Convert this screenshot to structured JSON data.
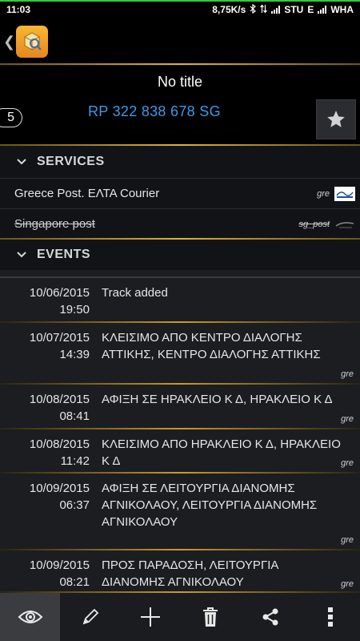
{
  "status_bar": {
    "time": "11:03",
    "net_speed": "8,75K/s",
    "carrier1": "STU",
    "net_type": "E",
    "carrier2": "WHA"
  },
  "header": {
    "title": "No title",
    "count": "5",
    "tracking_number": "RP 322 838 678 SG"
  },
  "services": {
    "label": "SERVICES",
    "items": [
      {
        "name": "Greece Post. ΕΛΤΑ Courier",
        "code": "gre"
      },
      {
        "name": "Singapore post",
        "code": "sg_post"
      }
    ]
  },
  "events": {
    "label": "EVENTS",
    "items": [
      {
        "date": "10/06/2015",
        "time": "19:50",
        "description": "Track added",
        "source": ""
      },
      {
        "date": "10/07/2015",
        "time": "14:39",
        "description": "ΚΛΕΙΣΙΜΟ ΑΠΟ ΚΕΝΤΡΟ ΔΙΑΛΟΓΗΣ ΑΤΤΙΚΗΣ, ΚΕΝΤΡΟ ΔΙΑΛΟΓΗΣ ΑΤΤΙΚΗΣ",
        "source": "gre"
      },
      {
        "date": "10/08/2015",
        "time": "08:41",
        "description": "ΑΦΙΞΗ ΣΕ ΗΡΑΚΛΕΙΟ Κ Δ, ΗΡΑΚΛΕΙΟ Κ Δ",
        "source": "gre"
      },
      {
        "date": "10/08/2015",
        "time": "11:42",
        "description": "ΚΛΕΙΣΙΜΟ ΑΠΟ ΗΡΑΚΛΕΙΟ Κ Δ, ΗΡΑΚΛΕΙΟ Κ Δ",
        "source": "gre"
      },
      {
        "date": "10/09/2015",
        "time": "06:37",
        "description": "ΑΦΙΞΗ ΣΕ ΛΕΙΤΟΥΡΓΙΑ ΔΙΑΝΟΜΗΣ ΑΓΝΙΚΟΛΑΟΥ, ΛΕΙΤΟΥΡΓΙΑ ΔΙΑΝΟΜΗΣ ΑΓΝΙΚΟΛΑΟΥ",
        "source": "gre"
      },
      {
        "date": "10/09/2015",
        "time": "08:21",
        "description": "ΠΡΟΣ ΠΑΡΑΔΟΣΗ, ΛΕΙΤΟΥΡΓΙΑ ΔΙΑΝΟΜΗΣ ΑΓΝΙΚΟΛΑΟΥ",
        "source": "gre"
      }
    ]
  },
  "toolbar": {
    "icons": [
      "eye-icon",
      "pencil-icon",
      "plus-icon",
      "trash-icon",
      "share-icon",
      "more-vert-icon"
    ]
  },
  "colors": {
    "accent_gold": "#e0b23c",
    "link_blue": "#3a9ae8",
    "status_green": "#2ecc40"
  }
}
